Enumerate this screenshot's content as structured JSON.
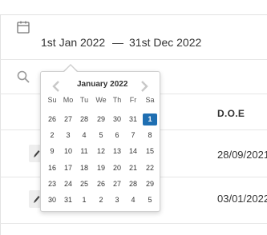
{
  "date_range": {
    "start": "1st Jan 2022",
    "separator": "—",
    "end": "31st Dec 2022"
  },
  "table": {
    "column_header": "D.O.E",
    "rows": [
      {
        "doe": "28/09/2021"
      },
      {
        "doe": "03/01/2022"
      }
    ]
  },
  "calendar": {
    "month_label": "January 2022",
    "weekdays": [
      "Su",
      "Mo",
      "Tu",
      "We",
      "Th",
      "Fr",
      "Sa"
    ],
    "weeks": [
      [
        "26",
        "27",
        "28",
        "29",
        "30",
        "31",
        "1"
      ],
      [
        "2",
        "3",
        "4",
        "5",
        "6",
        "7",
        "8"
      ],
      [
        "9",
        "10",
        "11",
        "12",
        "13",
        "14",
        "15"
      ],
      [
        "16",
        "17",
        "18",
        "19",
        "20",
        "21",
        "22"
      ],
      [
        "23",
        "24",
        "25",
        "26",
        "27",
        "28",
        "29"
      ],
      [
        "30",
        "31",
        "1",
        "2",
        "3",
        "4",
        "5"
      ]
    ],
    "selected_day": "1",
    "selected_color": "#1f6fb2"
  },
  "icons": {
    "calendar": "calendar-icon",
    "search": "search-icon",
    "prev": "chevron-left-icon",
    "next": "chevron-right-icon",
    "edit": "pencil-icon"
  }
}
